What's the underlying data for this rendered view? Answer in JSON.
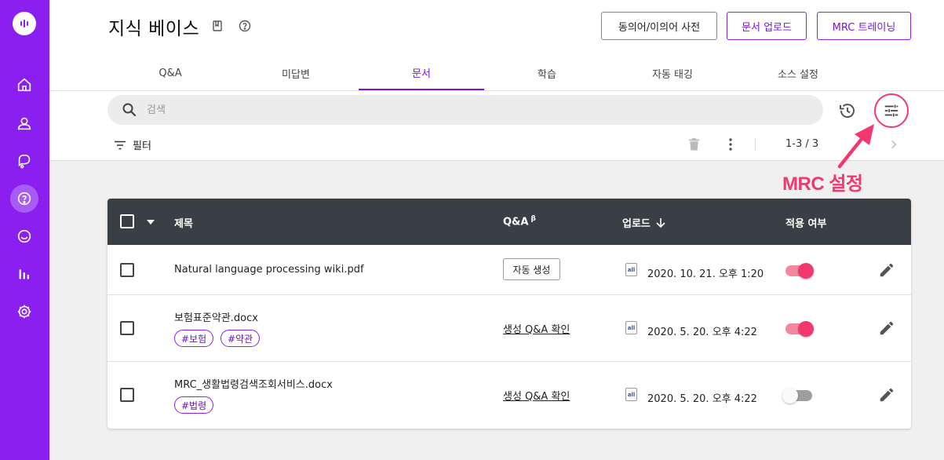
{
  "header": {
    "title": "지식 베이스",
    "buttons": {
      "synonym": "동의어/이의어 사전",
      "upload": "문서 업로드",
      "mrc_training": "MRC 트레이닝"
    }
  },
  "tabs": [
    {
      "label": "Q&A"
    },
    {
      "label": "미답변"
    },
    {
      "label": "문서"
    },
    {
      "label": "학습"
    },
    {
      "label": "자동 태깅"
    },
    {
      "label": "소스 설정"
    }
  ],
  "active_tab": "문서",
  "search": {
    "placeholder": "검색",
    "value": ""
  },
  "filter_label": "필터",
  "pagination": "1-3 / 3",
  "annotation": "MRC 설정",
  "table": {
    "columns": {
      "title": "제목",
      "qa": "Q&A",
      "qa_sup": "β",
      "upload": "업로드",
      "apply": "적용 여부"
    },
    "rows": [
      {
        "title": "Natural language processing wiki.pdf",
        "tags": [],
        "qa_action": "자동 생성",
        "qa_type": "button",
        "file_icon": "all",
        "date": "2020. 10. 21. 오후 1:20",
        "enabled": true
      },
      {
        "title": "보험표준약관.docx",
        "tags": [
          "#보험",
          "#약관"
        ],
        "qa_action": "생성 Q&A 확인",
        "qa_type": "link",
        "file_icon": "all",
        "date": "2020. 5. 20. 오후 4:22",
        "enabled": true
      },
      {
        "title": "MRC_생활법령검색조회서비스.docx",
        "tags": [
          "#법령"
        ],
        "qa_action": "생성 Q&A 확인",
        "qa_type": "link",
        "file_icon": "all",
        "date": "2020. 5. 20. 오후 4:22",
        "enabled": false
      }
    ]
  },
  "colors": {
    "brand": "#8a1ff0",
    "accent": "#f2396f",
    "header_dark": "#3a3f45"
  }
}
